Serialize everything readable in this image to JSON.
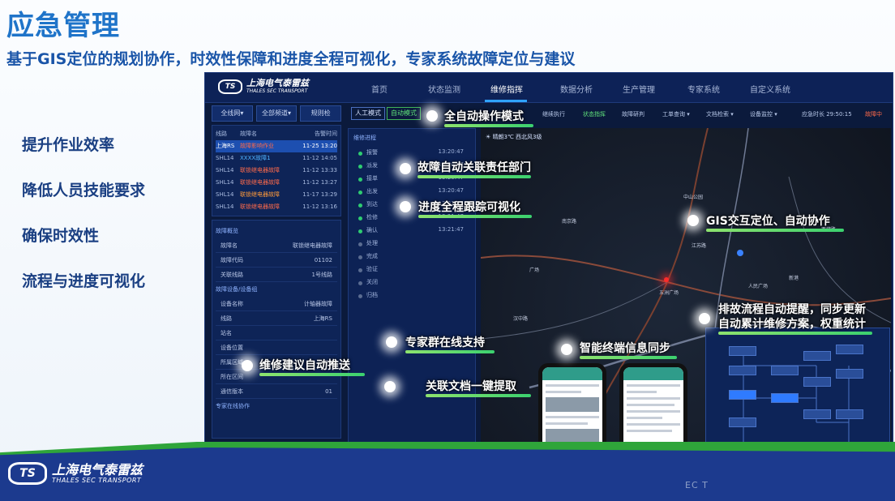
{
  "slide": {
    "title": "应急管理",
    "subtitle": "基于GIS定位的规划协作，时效性保障和进度全程可视化，专家系统故障定位与建议",
    "bullets": [
      "提升作业效率",
      "降低人员技能要求",
      "确保时效性",
      "流程与进度可视化"
    ],
    "logo_name": "上海电气泰雷兹",
    "logo_en": "THALES SEC TRANSPORT",
    "watermark": "EC T"
  },
  "app": {
    "logo_name": "上海电气泰雷兹",
    "logo_en": "THALES SEC TRANSPORT",
    "nav": [
      "首页",
      "状态监测",
      "维修指挥",
      "数据分析",
      "生产管理",
      "专家系统",
      "自定义系统"
    ],
    "nav_active_index": 2,
    "left_selects": [
      "全线网▾",
      "全部频道▾",
      "规则检"
    ],
    "line_table": {
      "headers": [
        "线路",
        "故障名",
        "告警时间"
      ],
      "rows": [
        {
          "line": "上海RS",
          "fault": "故障影响作业",
          "time": "11-25 13:20"
        },
        {
          "line": "SHL14",
          "fault": "XXXX故障1",
          "time": "11-12 14:05"
        },
        {
          "line": "SHL14",
          "fault": "联锁继电器故障",
          "time": "11-12 13:33"
        },
        {
          "line": "SHL14",
          "fault": "联锁继电器故障",
          "time": "11-12 13:27"
        },
        {
          "line": "SHL14",
          "fault": "联锁继电器故障",
          "time": "11-17 13:29"
        },
        {
          "line": "SHL14",
          "fault": "联锁继电器故障",
          "time": "11-12 13:16"
        }
      ],
      "selected_index": 0
    },
    "fault_panel": {
      "title": "故障概览",
      "rows": [
        {
          "k": "故障名",
          "v": "联锁继电器故障"
        },
        {
          "k": "故障代码",
          "v": "01102"
        },
        {
          "k": "关联线路",
          "v": "1号线路"
        }
      ],
      "section2_title": "故障设备/设备组",
      "rows2": [
        {
          "k": "设备名称",
          "v": "计轴器故障"
        },
        {
          "k": "线路",
          "v": "上海RS"
        },
        {
          "k": "站名",
          "v": ""
        },
        {
          "k": "设备位置",
          "v": ""
        },
        {
          "k": "所属区域",
          "v": "A1R1"
        },
        {
          "k": "所在区间",
          "v": ""
        },
        {
          "k": "通信版本",
          "v": "01"
        }
      ],
      "footer": "专家在线协作"
    },
    "toolbar": {
      "btn_manual": "人工模式",
      "btn_auto": "自动模式",
      "items": [
        "继续执行",
        "状态指挥",
        "故障研判",
        "工单查询 ▾",
        "文档检索 ▾",
        "设备监控 ▾",
        "应急时长 29:50:15",
        "故障中"
      ]
    },
    "process": {
      "title": "维修进程",
      "steps": [
        {
          "name": "报警",
          "time": "13:20:47",
          "done": true
        },
        {
          "name": "派发",
          "time": "13:20:47",
          "done": true
        },
        {
          "name": "接单",
          "time": "13:20:47",
          "done": true
        },
        {
          "name": "出发",
          "time": "13:20:47",
          "done": true
        },
        {
          "name": "到达",
          "time": "13:21:47",
          "done": true
        },
        {
          "name": "检修",
          "time": "13:21:47",
          "done": true
        },
        {
          "name": "确认",
          "time": "13:21:47",
          "done": true
        },
        {
          "name": "处理",
          "time": "",
          "done": false
        },
        {
          "name": "完成",
          "time": "",
          "done": false
        },
        {
          "name": "验证",
          "time": "",
          "done": false
        },
        {
          "name": "关闭",
          "time": "",
          "done": false
        },
        {
          "name": "归档",
          "time": "",
          "done": false
        }
      ]
    },
    "map": {
      "weather": "☀ 晴朗3℃ 西北风3级",
      "places": [
        "广场",
        "五洲广场",
        "南站",
        "新港",
        "江苏路",
        "人民广场",
        "南京路",
        "西藏路",
        "汉中路",
        "中山公园"
      ]
    }
  },
  "callouts": [
    "全自动操作模式",
    "故障自动关联责任部门",
    "进度全程跟踪可视化",
    "GIS交互定位、自动协作",
    "排故流程自动提醒，同步更新",
    "自动累计维修方案，权重统计",
    "专家群在线支持",
    "智能终端信息同步",
    "维修建议自动推送",
    "关联文档一键提取"
  ],
  "colors": {
    "title": "#1f74c9",
    "subtitle": "#1a55a8",
    "bullet": "#1a3f82",
    "band_green": "#2fa53a",
    "band_blue": "#1c3a8e",
    "callout_bar": "#3bd16f",
    "alarm": "#ff2b2b"
  }
}
